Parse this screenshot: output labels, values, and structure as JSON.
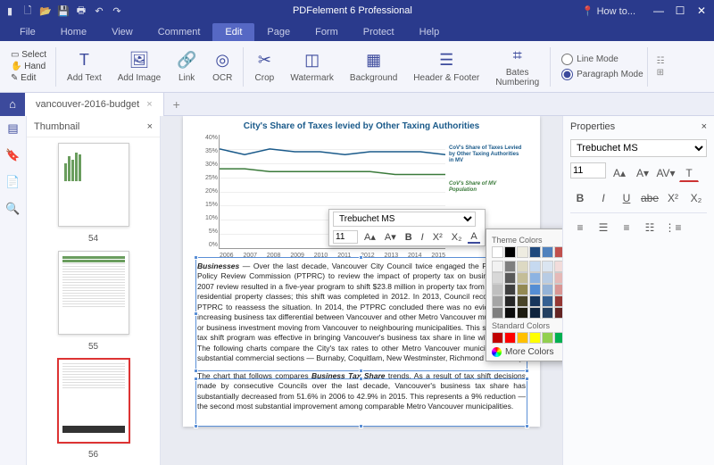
{
  "app": {
    "title": "PDFelement 6 Professional",
    "howto": "How to..."
  },
  "menu": {
    "tabs": [
      "File",
      "Home",
      "View",
      "Comment",
      "Edit",
      "Page",
      "Form",
      "Protect",
      "Help"
    ],
    "active": 4
  },
  "ribbon": {
    "select": "Select",
    "hand": "Hand",
    "edit": "Edit",
    "addText": "Add Text",
    "addImage": "Add Image",
    "link": "Link",
    "ocr": "OCR",
    "crop": "Crop",
    "watermark": "Watermark",
    "background": "Background",
    "headerFooter": "Header & Footer",
    "bates": "Bates\nNumbering",
    "lineMode": "Line Mode",
    "paraMode": "Paragraph Mode"
  },
  "doc": {
    "tab": "vancouver-2016-budget"
  },
  "thumb": {
    "title": "Thumbnail",
    "pages": [
      "54",
      "55",
      "56"
    ],
    "selected": 2
  },
  "chart_data": {
    "type": "line",
    "title": "City's Share of Taxes levied by Other Taxing Authorities",
    "x": [
      "2006",
      "2007",
      "2008",
      "2009",
      "2010",
      "2011",
      "2012",
      "2013",
      "2014",
      "2015"
    ],
    "series": [
      {
        "name": "CoV's Share of Taxes Levied by Other Taxing Authorities in MV",
        "color": "#1a5a8a",
        "values": [
          35,
          33,
          35,
          34,
          34,
          33,
          34,
          34,
          34,
          33
        ]
      },
      {
        "name": "CoV's Share of MV Population",
        "color": "#3a7a3a",
        "values": [
          28,
          28,
          27,
          27,
          27,
          27,
          27,
          26,
          26,
          26
        ]
      }
    ],
    "ylabel": "",
    "ylim": [
      0,
      40
    ],
    "yticks": [
      "0%",
      "5%",
      "10%",
      "15%",
      "20%",
      "25%",
      "30%",
      "35%",
      "40%"
    ]
  },
  "body": {
    "p1": "Businesses — Over the last decade, Vancouver City Council twice engaged the Property Tax Policy Review Commission (PTPRC) to review the impact of property tax on businesses. The 2007 review resulted in a five-year program to shift $23.8 million in property tax from business to residential property classes; this shift was completed in 2012. In 2013, Council reconvened the PTPRC to reassess the situation. In 2014, the PTPRC concluded there was no evidence of an increasing business tax differential between Vancouver and other Metro Vancouver municipalities, or business investment moving from Vancouver to neighbouring municipalities. This suggests the tax shift program was effective in bringing Vancouver's business tax share in line with its peers. The following charts compare the City's tax rates to other Metro Vancouver municipalities with substantial commercial sections — Burnaby, Coquitlam, New Westminster, Richmond and Surrey.",
    "p1lead": "Businesses",
    "p2": "The chart that follows compares Business Tax Share trends. As a result of tax shift decisions made by consecutive Councils over the last decade, Vancouver's business tax share has substantially decreased from 51.6% in 2006 to 42.9% in 2015. This represents a 9% reduction — the second most substantial improvement among comparable Metro Vancouver municipalities.",
    "p2bold": "Business Tax Share"
  },
  "floatfmt": {
    "font": "Trebuchet MS",
    "size": "11"
  },
  "colors": {
    "theme_label": "Theme Colors",
    "standard_label": "Standard Colors",
    "more": "More Colors",
    "theme_row1": [
      "#ffffff",
      "#000000",
      "#eeece1",
      "#1f497d",
      "#4f81bd",
      "#c0504d",
      "#9bbb59",
      "#8064a2",
      "#4bacc6",
      "#f79646"
    ],
    "theme_shades": [
      [
        "#f2f2f2",
        "#7f7f7f",
        "#ddd9c3",
        "#c6d9f0",
        "#dbe5f1",
        "#f2dcdb",
        "#ebf1dd",
        "#e5e0ec",
        "#dbeef3",
        "#fdeada"
      ],
      [
        "#d8d8d8",
        "#595959",
        "#c4bd97",
        "#8db3e2",
        "#b8cce4",
        "#e5b9b7",
        "#d7e3bc",
        "#ccc1d9",
        "#b7dde8",
        "#fbd5b5"
      ],
      [
        "#bfbfbf",
        "#3f3f3f",
        "#938953",
        "#548dd4",
        "#95b3d7",
        "#d99694",
        "#c3d69b",
        "#b2a2c7",
        "#92cddc",
        "#fac08f"
      ],
      [
        "#a5a5a5",
        "#262626",
        "#494429",
        "#17365d",
        "#366092",
        "#953734",
        "#76923c",
        "#5f497a",
        "#31859b",
        "#e36c09"
      ],
      [
        "#7f7f7f",
        "#0c0c0c",
        "#1d1b10",
        "#0f243e",
        "#244061",
        "#632423",
        "#4f6128",
        "#3f3151",
        "#205867",
        "#974806"
      ]
    ],
    "standard": [
      "#c00000",
      "#ff0000",
      "#ffc000",
      "#ffff00",
      "#92d050",
      "#00b050",
      "#00b0f0",
      "#0070c0",
      "#002060",
      "#7030a0"
    ]
  },
  "props": {
    "title": "Properties",
    "font": "Trebuchet MS",
    "size": "11"
  }
}
